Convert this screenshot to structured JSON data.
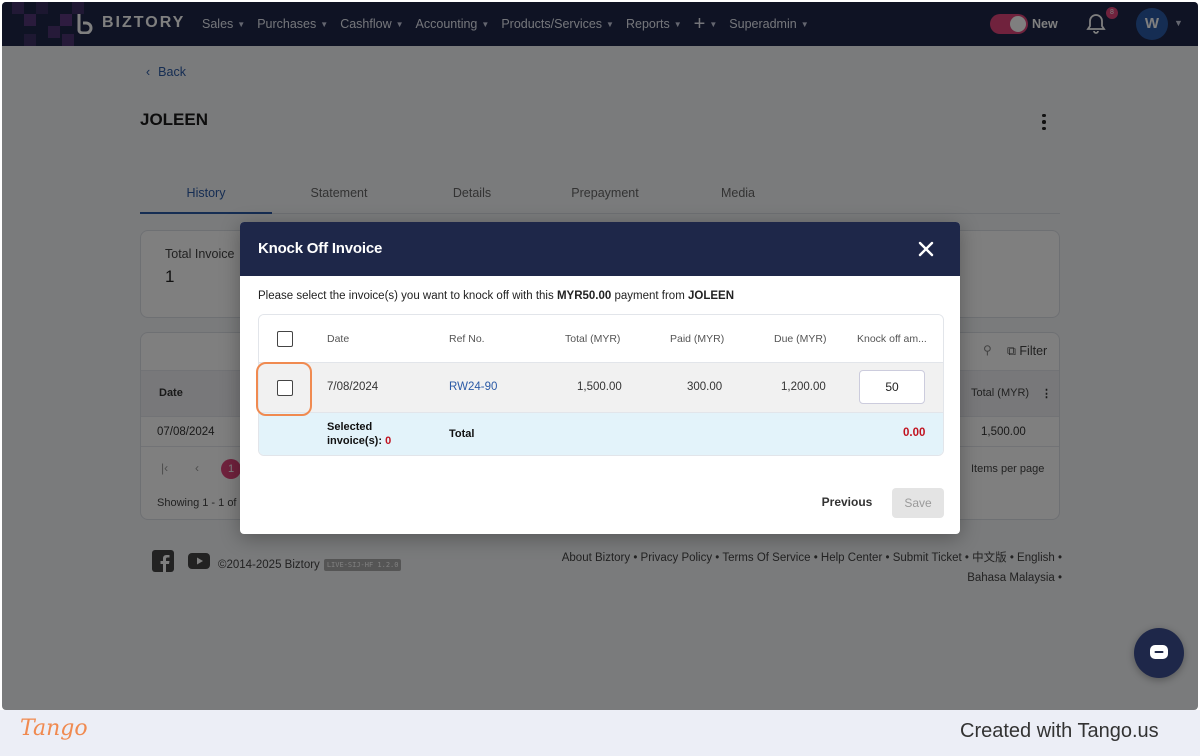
{
  "app": {
    "brand": "BIZTORY"
  },
  "nav": {
    "items": [
      {
        "label": "Sales"
      },
      {
        "label": "Purchases"
      },
      {
        "label": "Cashflow"
      },
      {
        "label": "Accounting"
      },
      {
        "label": "Products/Services"
      },
      {
        "label": "Reports"
      },
      {
        "label": "+"
      },
      {
        "label": "Superadmin"
      }
    ],
    "toggle_label": "New",
    "notification_count": "8",
    "avatar_initial": "W"
  },
  "page": {
    "back_label": "Back",
    "title": "JOLEEN",
    "tabs": [
      {
        "label": "History"
      },
      {
        "label": "Statement"
      },
      {
        "label": "Details"
      },
      {
        "label": "Prepayment"
      },
      {
        "label": "Media"
      }
    ],
    "active_tab": "History",
    "summary": {
      "label": "Total Invoice",
      "value": "1"
    },
    "filter_label": "Filter",
    "table_headers": {
      "date": "Date",
      "total": "Total (MYR)"
    },
    "row": {
      "date": "07/08/2024",
      "total": "1,500.00"
    },
    "pager": {
      "page": "1",
      "items_per_page_label": "Items per page",
      "showing": "Showing 1 - 1 of 1"
    }
  },
  "footer": {
    "copyright": "©2014-2025 Biztory",
    "version": "LIVE-SIJ-HF 1.2.0",
    "links": "About Biztory • Privacy Policy • Terms Of Service • Help Center • Submit Ticket • 中文版 • English • Bahasa Malaysia •"
  },
  "modal": {
    "title": "Knock Off Invoice",
    "desc_prefix": "Please select the invoice(s) you want to knock off with this ",
    "desc_amount": "MYR50.00",
    "desc_mid": " payment from ",
    "desc_customer": "JOLEEN",
    "headers": {
      "date": "Date",
      "ref": "Ref No.",
      "total": "Total (MYR)",
      "paid": "Paid (MYR)",
      "due": "Due (MYR)",
      "knock": "Knock off am..."
    },
    "row": {
      "date": "7/08/2024",
      "ref": "RW24-90",
      "total": "1,500.00",
      "paid": "300.00",
      "due": "1,200.00",
      "knock": "50"
    },
    "selected_label": "Selected",
    "selected_label2": "invoice(s): ",
    "selected_count": "0",
    "total_label": "Total",
    "total_value": "0.00",
    "previous_label": "Previous",
    "save_label": "Save"
  },
  "tango": {
    "logo": "Tango",
    "credit": "Created with Tango.us"
  },
  "colors": {
    "nav": "#1e2749",
    "accent": "#2b5aa6",
    "pink": "#e0457b",
    "highlight": "#f08a50",
    "total_red": "#c1121f"
  }
}
